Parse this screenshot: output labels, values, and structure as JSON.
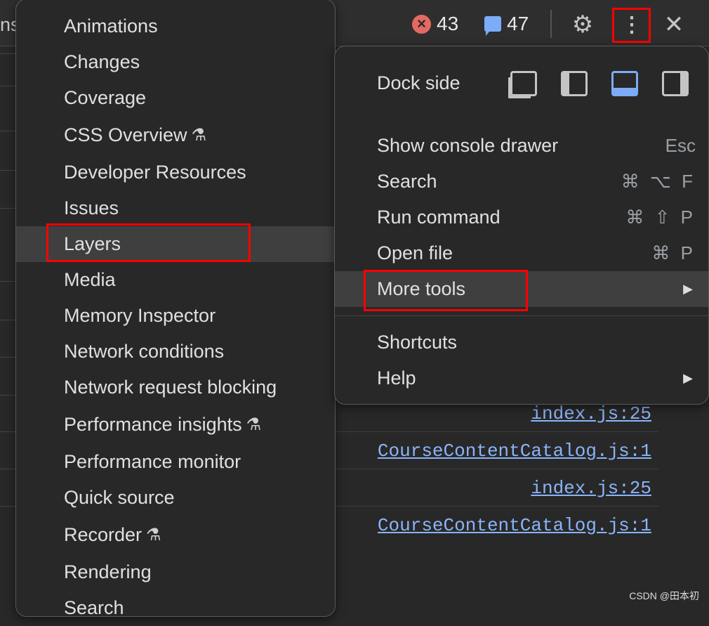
{
  "toolbar": {
    "tab_fragment": "ns",
    "errors": "43",
    "messages": "47",
    "icons": [
      "error-icon",
      "message-icon",
      "gear-icon",
      "more-vert-icon",
      "close-icon"
    ]
  },
  "more_tools_menu": {
    "items": [
      {
        "label": "Animations"
      },
      {
        "label": "Changes"
      },
      {
        "label": "Coverage"
      },
      {
        "label": "CSS Overview",
        "experimental": true
      },
      {
        "label": "Developer Resources"
      },
      {
        "label": "Issues"
      },
      {
        "label": "Layers",
        "highlighted": true
      },
      {
        "label": "Media"
      },
      {
        "label": "Memory Inspector"
      },
      {
        "label": "Network conditions"
      },
      {
        "label": "Network request blocking"
      },
      {
        "label": "Performance insights",
        "experimental": true
      },
      {
        "label": "Performance monitor"
      },
      {
        "label": "Quick source"
      },
      {
        "label": "Recorder",
        "experimental": true
      },
      {
        "label": "Rendering"
      },
      {
        "label": "Search"
      }
    ]
  },
  "main_menu": {
    "dock_side_label": "Dock side",
    "dock_options": [
      "undock",
      "dock-left",
      "dock-bottom",
      "dock-right"
    ],
    "dock_selected": "dock-bottom",
    "items": [
      {
        "label": "Show console drawer",
        "shortcut": "Esc"
      },
      {
        "label": "Search",
        "shortcut": "⌘ ⌥ F"
      },
      {
        "label": "Run command",
        "shortcut": "⌘ ⇧ P"
      },
      {
        "label": "Open file",
        "shortcut": "⌘ P"
      },
      {
        "label": "More tools",
        "shortcut": "▶"
      },
      {
        "label": "Shortcuts",
        "shortcut": ""
      },
      {
        "label": "Help",
        "shortcut": "▶"
      }
    ]
  },
  "console_links": [
    "index.js:25",
    "CourseContentCatalog.js:1",
    "index.js:25",
    "CourseContentCatalog.js:1"
  ],
  "watermark": "CSDN @田本初",
  "colors": {
    "accent": "#7cacf8",
    "error": "#e46962",
    "link": "#8ab4f8",
    "highlight_box": "#ff0000"
  }
}
